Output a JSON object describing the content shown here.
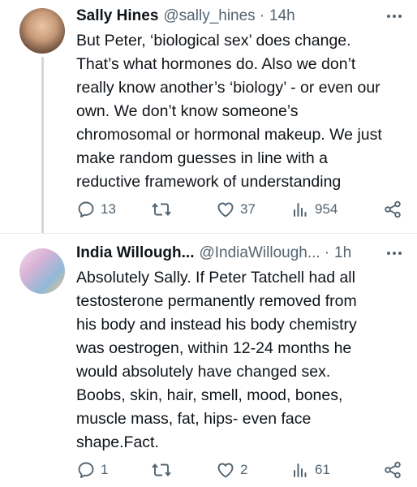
{
  "tweets": [
    {
      "author_name": "Sally Hines",
      "handle": "@sally_hines",
      "separator": "·",
      "time": "14h",
      "text": "But Peter, ‘biological sex’ does change.\nThat’s what hormones do. Also we don’t\nreally know another’s ‘biology’ - or even our\nown. We don’t know someone’s\nchromosomal or hormonal makeup. We just\nmake random guesses in line with a\nreductive framework of understanding",
      "replies": "13",
      "retweets": "",
      "likes": "37",
      "views": "954"
    },
    {
      "author_name": "India Willough...",
      "handle": "@IndiaWillough...",
      "separator": "·",
      "time": "1h",
      "text": "Absolutely Sally. If Peter Tatchell had all\ntestosterone permanently removed from\nhis body and instead his body chemistry\nwas oestrogen, within 12-24 months he\nwould  absolutely have changed sex.\nBoobs, skin, hair, smell, mood, bones,\nmuscle mass, fat, hips- even face\nshape.Fact.",
      "replies": "1",
      "retweets": "",
      "likes": "2",
      "views": "61"
    }
  ],
  "icons": {
    "reply": "reply-icon",
    "retweet": "retweet-icon",
    "like": "heart-icon",
    "views": "views-icon",
    "share": "share-icon",
    "more": "more-icon"
  },
  "colors": {
    "text": "#0f1419",
    "secondary": "#536471",
    "thread_line": "#cfd9de"
  }
}
